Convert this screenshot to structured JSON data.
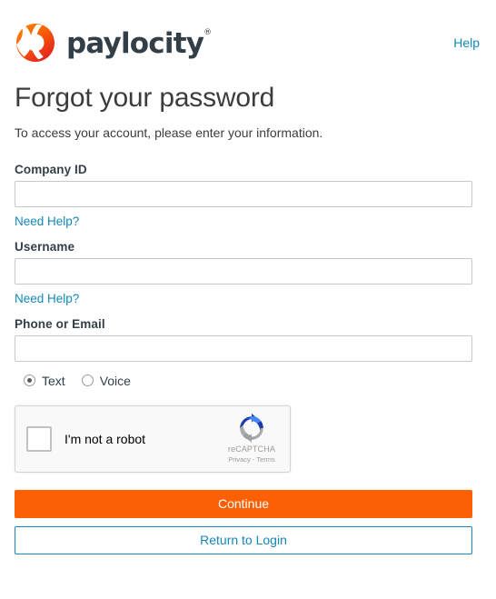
{
  "brand": {
    "logo_icon": "paylocity-ring-logo",
    "wordmark": "paylocity",
    "trademark": "®",
    "colors": {
      "logo_orange": "#FB6104",
      "logo_red": "#E8322A",
      "wordmark": "#333F48"
    }
  },
  "header": {
    "help_label": "Help",
    "help_color": "#1488B8"
  },
  "main": {
    "title": "Forgot your password",
    "subtitle": "To access your account, please enter your information."
  },
  "form": {
    "fields": [
      {
        "label": "Company ID",
        "value": "",
        "placeholder": "",
        "help_label": "Need Help?"
      },
      {
        "label": "Username",
        "value": "",
        "placeholder": "",
        "help_label": "Need Help?"
      },
      {
        "label": "Phone or Email",
        "value": "",
        "placeholder": ""
      }
    ],
    "delivery_options": [
      {
        "label": "Text",
        "selected": true
      },
      {
        "label": "Voice",
        "selected": false
      }
    ]
  },
  "recaptcha": {
    "checkbox_checked": false,
    "label": "I'm not a robot",
    "brand_name": "reCAPTCHA",
    "legal": "Privacy - Terms",
    "privacy_label": "Privacy",
    "terms_label": "Terms",
    "logo_icon": "recaptcha-arrows-icon"
  },
  "actions": {
    "primary_label": "Continue",
    "primary_color": "#FB6104",
    "secondary_label": "Return to Login",
    "secondary_color": "#1488B8"
  }
}
